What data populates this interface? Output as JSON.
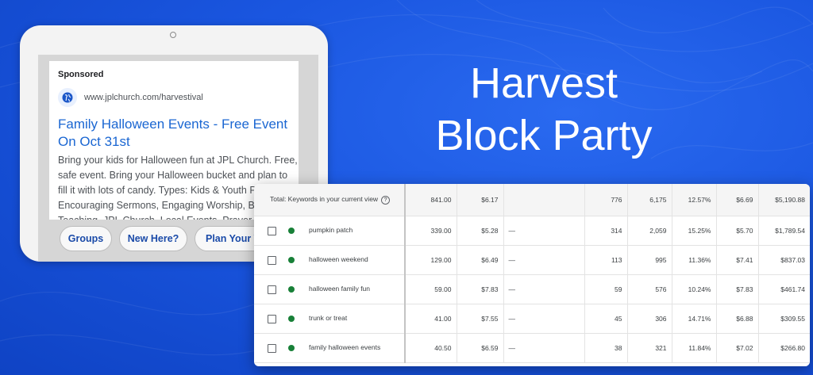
{
  "colors": {
    "background": "#1a56e0",
    "link": "#1a66d2",
    "status_dot": "#188038"
  },
  "ad": {
    "sponsored": "Sponsored",
    "icon": "globe-icon",
    "url": "www.jplchurch.com/harvestival",
    "title": "Family Halloween Events - Free Event On Oct 31st",
    "description": "Bring your kids for Halloween fun at JPL Church. Free, safe event. Bring your Halloween bucket and plan to fill it with lots of candy. Types: Kids & Youth Programs, Encouraging Sermons, Engaging Worship, Biblical Teaching, JPL Church, Local Events, Prayer from",
    "sitelinks": [
      "Groups",
      "New Here?",
      "Plan Your Visit"
    ]
  },
  "headline": {
    "line1": "Harvest",
    "line2": "Block Party"
  },
  "table": {
    "total": {
      "label": "Total: Keywords in your current view",
      "help_icon": "help-circle-icon",
      "cells": [
        "841.00",
        "$6.17",
        "",
        "776",
        "6,175",
        "12.57%",
        "$6.69",
        "$5,190.88"
      ]
    },
    "rows": [
      {
        "keyword": "pumpkin patch",
        "cells": [
          "339.00",
          "$5.28",
          "—",
          "314",
          "2,059",
          "15.25%",
          "$5.70",
          "$1,789.54"
        ]
      },
      {
        "keyword": "halloween weekend",
        "cells": [
          "129.00",
          "$6.49",
          "—",
          "113",
          "995",
          "11.36%",
          "$7.41",
          "$837.03"
        ]
      },
      {
        "keyword": "halloween family fun",
        "cells": [
          "59.00",
          "$7.83",
          "—",
          "59",
          "576",
          "10.24%",
          "$7.83",
          "$461.74"
        ]
      },
      {
        "keyword": "trunk or treat",
        "cells": [
          "41.00",
          "$7.55",
          "—",
          "45",
          "306",
          "14.71%",
          "$6.88",
          "$309.55"
        ]
      },
      {
        "keyword": "family halloween events",
        "cells": [
          "40.50",
          "$6.59",
          "—",
          "38",
          "321",
          "11.84%",
          "$7.02",
          "$266.80"
        ]
      }
    ]
  }
}
